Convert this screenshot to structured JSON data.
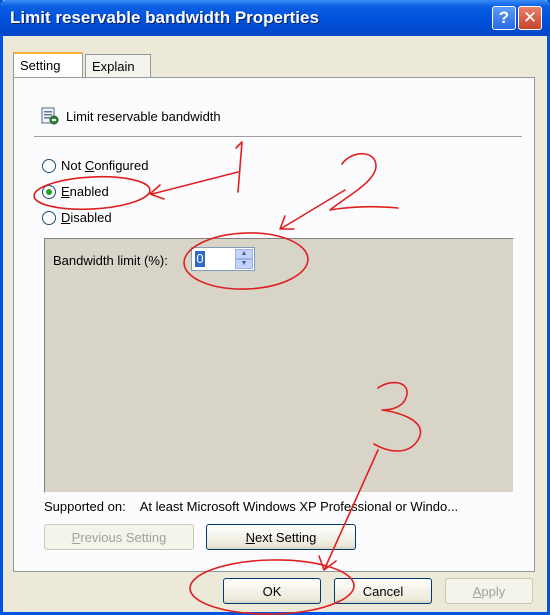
{
  "window": {
    "title": "Limit reservable bandwidth Properties",
    "help_glyph": "?",
    "close_glyph": "✕"
  },
  "tabs": [
    {
      "label": "Setting",
      "active": true
    },
    {
      "label": "Explain",
      "active": false
    }
  ],
  "policy": {
    "name": "Limit reservable bandwidth"
  },
  "radios": [
    {
      "label_pre": "Not ",
      "label_u": "C",
      "label_post": "onfigured",
      "selected": false
    },
    {
      "label_pre": "",
      "label_u": "E",
      "label_post": "nabled",
      "selected": true
    },
    {
      "label_pre": "",
      "label_u": "D",
      "label_post": "isabled",
      "selected": false
    }
  ],
  "options": {
    "bandwidth_label": "Bandwidth limit (%):",
    "bandwidth_value": "0"
  },
  "supported": {
    "label": "Supported on:",
    "value": "At least Microsoft Windows XP Professional or Windo..."
  },
  "nav": {
    "prev_u": "P",
    "prev_rest": "revious Setting",
    "next_u": "N",
    "next_rest": "ext Setting"
  },
  "footer": {
    "ok": "OK",
    "cancel": "Cancel",
    "apply_u": "A",
    "apply_rest": "pply"
  },
  "annotations": {
    "color": "#e02020",
    "labels": [
      "1",
      "2",
      "3"
    ]
  },
  "colors": {
    "titlebar": "#0050dc",
    "selected_radio": "#21a121",
    "selection": "#316ac5"
  }
}
